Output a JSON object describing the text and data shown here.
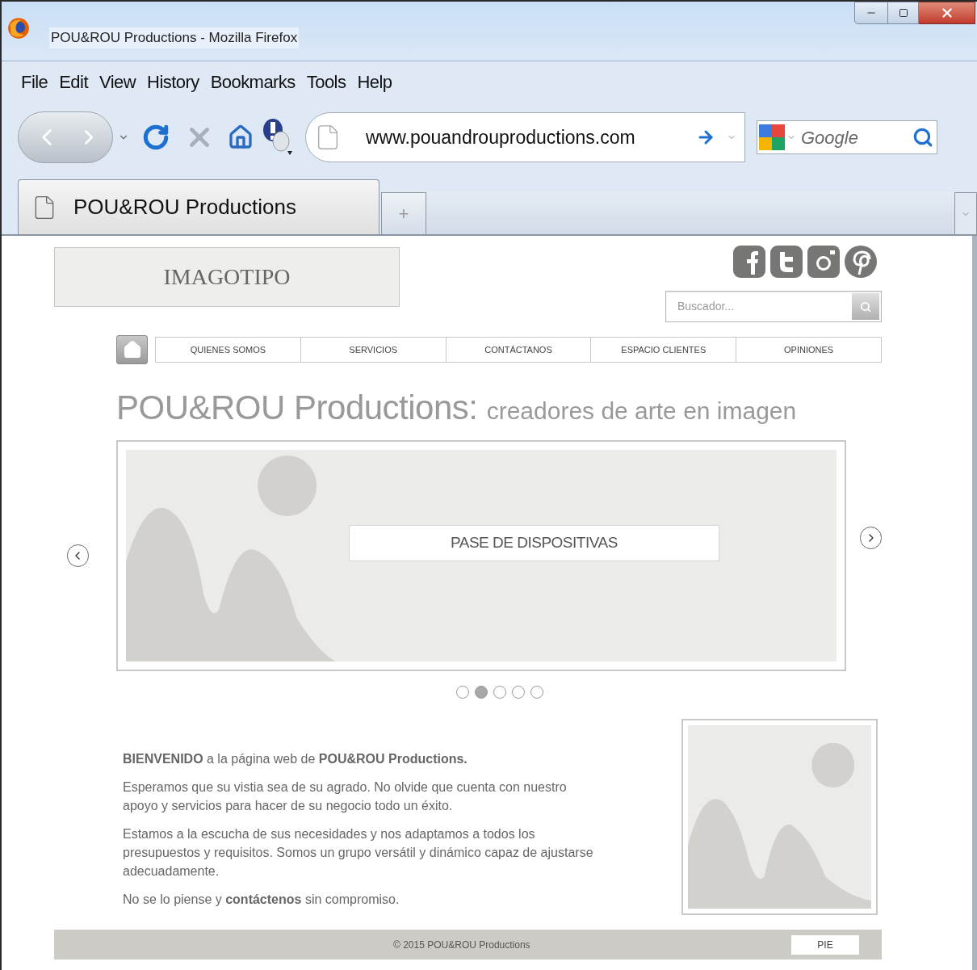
{
  "window": {
    "title": "POU&ROU Productions - Mozilla Firefox"
  },
  "menu": [
    "File",
    "Edit",
    "View",
    "History",
    "Bookmarks",
    "Tools",
    "Help"
  ],
  "toolbar": {
    "url": "www.pouandrouproductions.com",
    "search_placeholder": "Google"
  },
  "tabs": [
    {
      "label": "POU&ROU Productions",
      "selected": true
    }
  ],
  "new_tab": "+",
  "page": {
    "logo": "IMAGOTIPO",
    "search": {
      "placeholder": "Buscador..."
    },
    "nav": [
      "QUIENES SOMOS",
      "SERVICIOS",
      "CONTÁCTANOS",
      "ESPACIO CLIENTES",
      "OPINIONES"
    ],
    "heading": {
      "title": "POU&ROU Productions:",
      "subtitle": "creadores de arte en imagen"
    },
    "slideshow": {
      "caption": "PASE DE DISPOSITIVAS",
      "dots": [
        {
          "selected": false
        },
        {
          "selected": true
        },
        {
          "selected": false
        },
        {
          "selected": false
        },
        {
          "selected": false
        }
      ]
    },
    "welcome": [
      "**BIENVENIDO** a la página web de **POU&ROU Productions.**",
      "Esperamos que su vistia sea de su agrado. No olvide que cuenta con nuestro apoyo y servicios para hacer de su negocio todo un éxito.",
      "Estamos a la escucha de sus necesidades y nos adaptamos a todos los presupuestos y requisitos. Somos un grupo versátil y dinámico capaz de ajustarse adecuadamente.",
      "No se lo piense y **contáctenos** sin compromiso."
    ],
    "footer": {
      "copyright": "© 2015 POU&ROU Productions",
      "label": "PIE"
    }
  }
}
